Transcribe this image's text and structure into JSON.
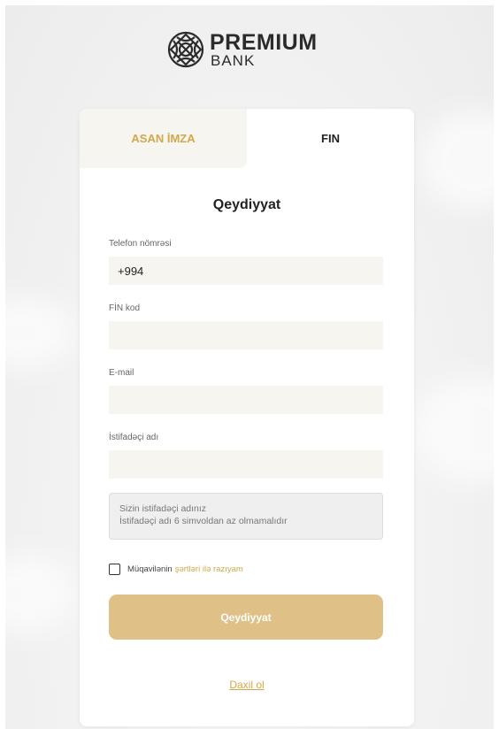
{
  "brand": {
    "name": "PREMIUM",
    "subtitle": "BANK",
    "logo_icon": "knot-emblem-icon"
  },
  "tabs": [
    {
      "label": "ASAN İMZA",
      "active": false
    },
    {
      "label": "FIN",
      "active": true
    }
  ],
  "form": {
    "title": "Qeydiyyat",
    "phone": {
      "label": "Telefon nömrəsi",
      "value": "+994"
    },
    "fin": {
      "label": "FİN kod",
      "value": ""
    },
    "email": {
      "label": "E-mail",
      "value": ""
    },
    "username": {
      "label": "İstifadəçi adı",
      "value": ""
    },
    "hint": {
      "line1": "Sizin istifadəçi adınız",
      "line2": "İstifadəçi adı 6 simvoldan az olmamalıdır"
    },
    "agree": {
      "prefix": "Müqavilənin",
      "link": "şərtləri ilə razıyam",
      "checked": false
    },
    "submit_label": "Qeydiyyat",
    "login_link": "Daxil ol"
  },
  "colors": {
    "accent": "#d2a84c",
    "button": "#dfc187",
    "input_bg": "#f7f5ef"
  }
}
